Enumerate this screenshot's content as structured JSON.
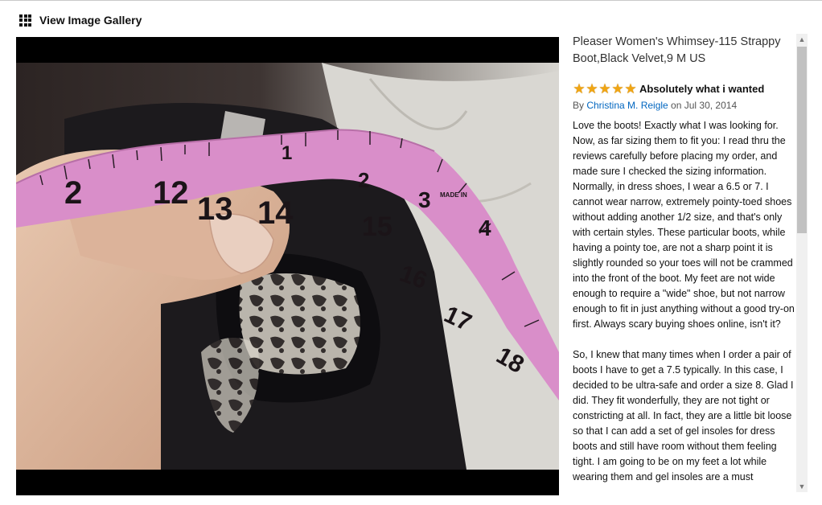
{
  "header": {
    "gallery_label": "View Image Gallery",
    "icon": "grid-icon"
  },
  "product": {
    "title": "Pleaser Women's Whimsey-115 Strappy Boot,Black Velvet,9 M US"
  },
  "review": {
    "rating": 5,
    "rating_max": 5,
    "title": "Absolutely what i wanted",
    "by_prefix": "By ",
    "author": "Christina M. Reigle",
    "date_prefix": " on ",
    "date": "Jul 30, 2014",
    "paragraphs": [
      "Love the boots! Exactly what I was looking for. Now, as far sizing them to fit you: I read thru the reviews carefully before placing my order, and made sure I checked the sizing information. Normally, in dress shoes, I wear a 6.5 or 7. I cannot wear narrow, extremely pointy-toed shoes without adding another 1/2 size, and that's only with certain styles. These particular boots, while having a pointy toe, are not a sharp point it is slightly rounded so your toes will not be crammed into the front of the boot. My feet are not wide enough to require a \"wide\" shoe, but not narrow enough to fit in just anything without a good try-on first. Always scary buying shoes online, isn't it?",
      "So, I knew that many times when I order a pair of boots I have to get a 7.5 typically. In this case, I decided to be ultra-safe and order a size 8. Glad I did. They fit wonderfully, they are not tight or constricting at all. In fact, they are a little bit loose so that I can add a set of gel insoles for dress boots and still have room without them feeling tight. I am going to be on my feet a lot while wearing them and gel insoles are a must"
    ]
  },
  "photo": {
    "tape_numbers": [
      "2",
      "12",
      "13",
      "14",
      "15",
      "16",
      "17",
      "18",
      "1",
      "2",
      "3",
      "4"
    ],
    "tape_text": "MADE IN"
  },
  "scrollbar": {
    "up_icon": "▲",
    "down_icon": "▼"
  }
}
